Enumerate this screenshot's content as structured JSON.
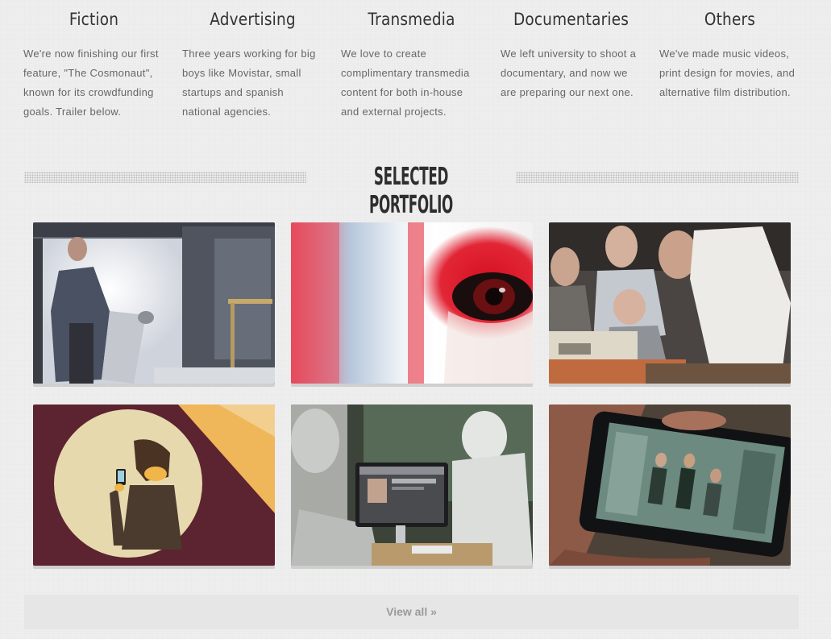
{
  "services": [
    {
      "title": "Fiction",
      "text": "We're now finishing our first feature, \"The Cosmonaut\", known for its crowdfunding goals. Trailer below."
    },
    {
      "title": "Advertising",
      "text": "Three years working for big boys like Movistar, small startups and spanish national agencies."
    },
    {
      "title": "Transmedia",
      "text": "We love to create complimentary transmedia content for both in-house and external projects."
    },
    {
      "title": "Documentaries",
      "text": "We left university to shoot a documentary, and now we are preparing our next one."
    },
    {
      "title": "Others",
      "text": "We've made music videos, print design for movies, and alternative film distribution."
    }
  ],
  "portfolio": {
    "heading": "SELECTED PORTFOLIO",
    "items": [
      {
        "icon": "cosmonaut-still-image"
      },
      {
        "icon": "red-eye-closeup-image"
      },
      {
        "icon": "team-at-computer-image"
      },
      {
        "icon": "illustration-phone-man-image"
      },
      {
        "icon": "lab-computer-image"
      },
      {
        "icon": "hand-holding-phone-image"
      }
    ],
    "view_all": "View all »"
  }
}
